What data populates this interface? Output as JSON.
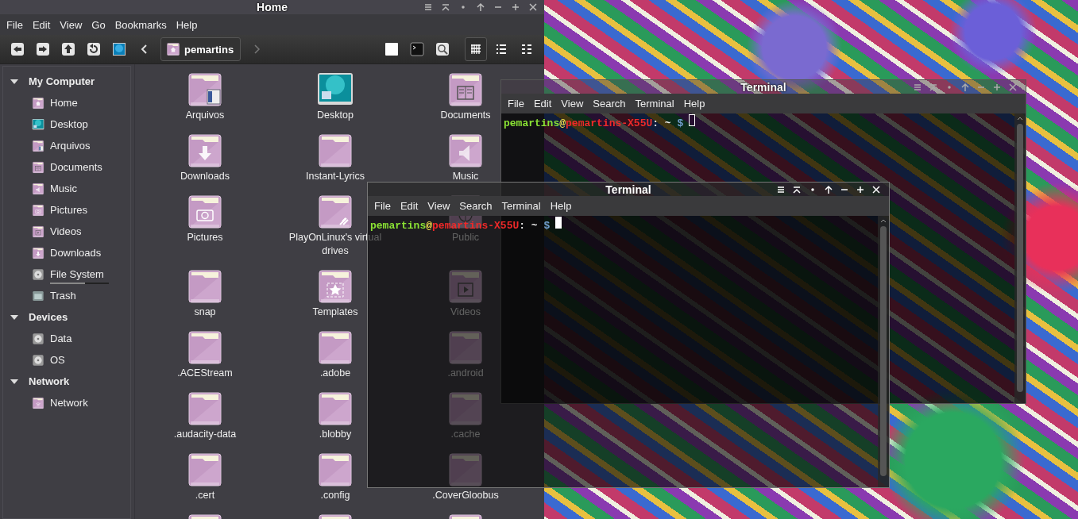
{
  "file_manager": {
    "title": "Home",
    "menu": [
      "File",
      "Edit",
      "View",
      "Go",
      "Bookmarks",
      "Help"
    ],
    "location": "pemartins",
    "views": [
      {
        "kind": "icons",
        "selected": true
      },
      {
        "kind": "list",
        "selected": false
      },
      {
        "kind": "compact",
        "selected": false
      }
    ],
    "sidebar": [
      {
        "title": "My Computer",
        "expanded": true,
        "items": [
          {
            "label": "Home",
            "kind": "home"
          },
          {
            "label": "Desktop",
            "kind": "desktop"
          },
          {
            "label": "Arquivos",
            "kind": "arquivos"
          },
          {
            "label": "Documents",
            "kind": "documents"
          },
          {
            "label": "Music",
            "kind": "music"
          },
          {
            "label": "Pictures",
            "kind": "pictures"
          },
          {
            "label": "Videos",
            "kind": "videos"
          },
          {
            "label": "Downloads",
            "kind": "downloads"
          },
          {
            "label": "File System",
            "kind": "drive",
            "level": 0.6
          },
          {
            "label": "Trash",
            "kind": "trash"
          }
        ]
      },
      {
        "title": "Devices",
        "expanded": true,
        "items": [
          {
            "label": "Data",
            "kind": "drive"
          },
          {
            "label": "OS",
            "kind": "drive"
          }
        ]
      },
      {
        "title": "Network",
        "expanded": true,
        "items": [
          {
            "label": "Network",
            "kind": "network"
          }
        ]
      }
    ],
    "files": [
      {
        "name": "Arquivos",
        "kind": "arquivos"
      },
      {
        "name": "Desktop",
        "kind": "desktop"
      },
      {
        "name": "Documents",
        "kind": "documents"
      },
      {
        "name": "Downloads",
        "kind": "downloads"
      },
      {
        "name": "Instant-Lyrics",
        "kind": "folder"
      },
      {
        "name": "Music",
        "kind": "music"
      },
      {
        "name": "Pictures",
        "kind": "pictures"
      },
      {
        "name": "PlayOnLinux's virtual drives",
        "kind": "playonlinux"
      },
      {
        "name": "Public",
        "kind": "public"
      },
      {
        "name": "snap",
        "kind": "folder"
      },
      {
        "name": "Templates",
        "kind": "templates"
      },
      {
        "name": "Videos",
        "kind": "videos"
      },
      {
        "name": ".ACEStream",
        "kind": "folder"
      },
      {
        "name": ".adobe",
        "kind": "folder"
      },
      {
        "name": ".android",
        "kind": "folder"
      },
      {
        "name": ".audacity-data",
        "kind": "folder"
      },
      {
        "name": ".blobby",
        "kind": "folder"
      },
      {
        "name": ".cache",
        "kind": "folder"
      },
      {
        "name": ".cert",
        "kind": "folder"
      },
      {
        "name": ".config",
        "kind": "folder"
      },
      {
        "name": ".CoverGloobus",
        "kind": "folder"
      },
      {
        "kind": "folder"
      },
      {
        "kind": "folder"
      },
      {
        "kind": "folder"
      }
    ]
  },
  "terminals": [
    {
      "title": "Terminal",
      "focused": false,
      "menu": [
        "File",
        "Edit",
        "View",
        "Search",
        "Terminal",
        "Help"
      ],
      "prompt": {
        "user": "pemartins",
        "at": "@",
        "host": "pemartins-X55U",
        "path": ": ~",
        "symbol": "$"
      }
    },
    {
      "title": "Terminal",
      "focused": true,
      "menu": [
        "File",
        "Edit",
        "View",
        "Search",
        "Terminal",
        "Help"
      ],
      "prompt": {
        "user": "pemartins",
        "at": "@",
        "host": "pemartins-X55U",
        "path": ": ~",
        "symbol": "$"
      }
    }
  ]
}
